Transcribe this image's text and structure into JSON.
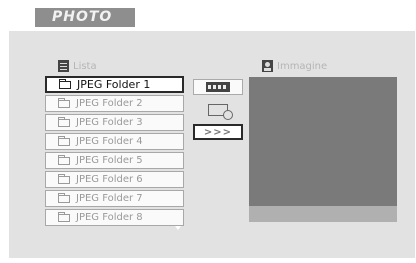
{
  "header": {
    "title": "PHOTO"
  },
  "list": {
    "label": "Lista",
    "icon": "list-icon",
    "folders": [
      "JPEG Folder 1",
      "JPEG Folder 2",
      "JPEG Folder 3",
      "JPEG Folder 4",
      "JPEG Folder 5",
      "JPEG Folder 6",
      "JPEG Folder 7",
      "JPEG Folder 8"
    ],
    "selected_index": 0
  },
  "controls": {
    "slideshow_icon": "film-strip-icon",
    "rotate_icon": "rotate-image-icon",
    "next_label": ">>>"
  },
  "preview": {
    "label": "Immagine",
    "icon": "image-icon"
  },
  "colors": {
    "panel": "#e2e2e2",
    "header_tab": "#8e8e8e",
    "preview": "#7a7a7a",
    "selection_border": "#2a2a2a"
  }
}
